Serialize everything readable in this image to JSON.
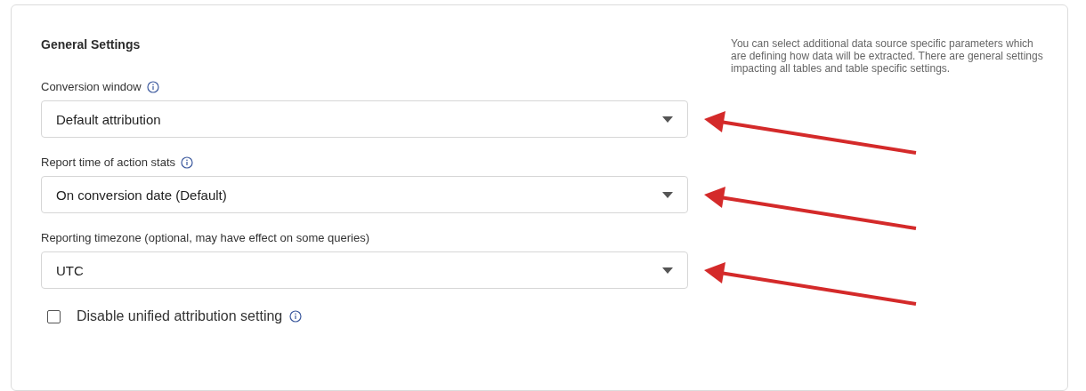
{
  "section": {
    "title": "General Settings"
  },
  "fields": [
    {
      "label": "Conversion window",
      "info": true,
      "value": "Default attribution",
      "arrow": true
    },
    {
      "label": "Report time of action stats",
      "info": true,
      "value": "On conversion date (Default)",
      "arrow": true
    },
    {
      "label": "Reporting timezone (optional, may have effect on some queries)",
      "info": false,
      "value": "UTC",
      "arrow": true
    }
  ],
  "checkbox": {
    "label": "Disable unified attribution setting",
    "checked": false,
    "info": true
  },
  "help_text": "You can select additional data source specific parameters which are defining how data will be extracted. There are general settings impacting all tables and table specific settings."
}
